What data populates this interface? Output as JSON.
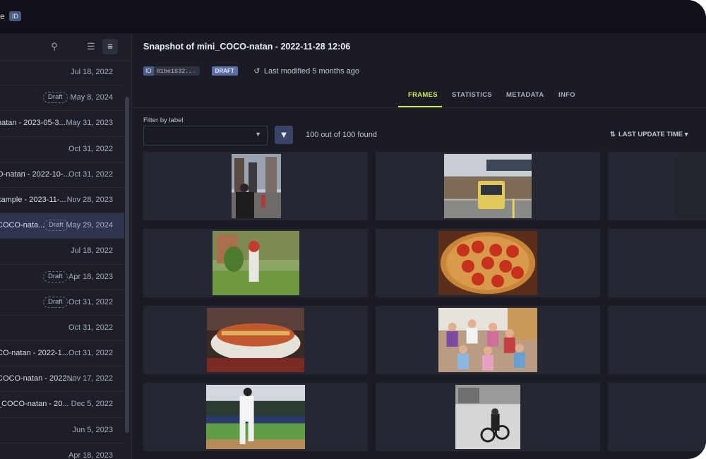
{
  "app": {
    "title_tail": "e",
    "id_chip": "ID"
  },
  "sidebar": {
    "icons": [
      "search-icon",
      "list-icon",
      "tree-list-icon"
    ],
    "items": [
      {
        "name": "",
        "draft": "",
        "date": "Jul 18, 2022"
      },
      {
        "name": "",
        "draft": "Draft",
        "date": "May 8, 2024"
      },
      {
        "name": "natan - 2023-05-3...",
        "draft": "",
        "date": "May 31, 2023"
      },
      {
        "name": "",
        "draft": "",
        "date": "Oct 31, 2022"
      },
      {
        "name": "O-natan - 2022-10-...",
        "draft": "",
        "date": "Oct 31, 2022"
      },
      {
        "name": "xample - 2023-11-...",
        "draft": "",
        "date": "Nov 28, 2023"
      },
      {
        "name": "COCO-nata...",
        "draft": "Draft",
        "date": "May 29, 2024",
        "selected": true
      },
      {
        "name": "",
        "draft": "",
        "date": "Jul 18, 2022"
      },
      {
        "name": "",
        "draft": "Draft",
        "date": "Apr 18, 2023"
      },
      {
        "name": "",
        "draft": "Draft",
        "date": "Oct 31, 2022"
      },
      {
        "name": "",
        "draft": "",
        "date": "Oct 31, 2022"
      },
      {
        "name": "CO-natan - 2022-1...",
        "draft": "",
        "date": "Oct 31, 2022"
      },
      {
        "name": "COCO-natan - 2022...",
        "draft": "",
        "date": "Nov 17, 2022"
      },
      {
        "name": "_COCO-natan - 20...",
        "draft": "",
        "date": "Dec 5, 2022"
      },
      {
        "name": "",
        "draft": "",
        "date": "Jun 5, 2023"
      },
      {
        "name": "",
        "draft": "",
        "date": "Apr 18, 2023"
      }
    ]
  },
  "main": {
    "title": "Snapshot of mini_COCO-natan - 2022-11-28 12:06",
    "id_prefix": "ID",
    "id_value": "01be1632...",
    "status": "DRAFT",
    "last_modified": "Last modified 5 months ago",
    "tabs": [
      "FRAMES",
      "STATISTICS",
      "METADATA",
      "INFO"
    ],
    "active_tab": "FRAMES",
    "filter_label": "Filter by label",
    "filter_value": "",
    "found_text": "100 out of 100 found",
    "sort_label": "LAST UPDATE TIME"
  },
  "frames": [
    {
      "scene": "street-crowd"
    },
    {
      "scene": "bus-bridge"
    },
    {
      "scene": "partial-light"
    },
    {
      "scene": "fire-hydrant"
    },
    {
      "scene": "pizza"
    },
    {
      "scene": "kitchen-partial"
    },
    {
      "scene": "pizza-plate"
    },
    {
      "scene": "kids-room"
    },
    {
      "scene": "partial-wall"
    },
    {
      "scene": "baseball"
    },
    {
      "scene": "motorcycle-snow"
    },
    {
      "scene": "night-clock"
    }
  ],
  "colors": {
    "accent": "#c8f04a",
    "background": "#1a1b24",
    "sidebar": "#1d1e28",
    "selected_row": "#2f3450",
    "tile": "#252733"
  }
}
